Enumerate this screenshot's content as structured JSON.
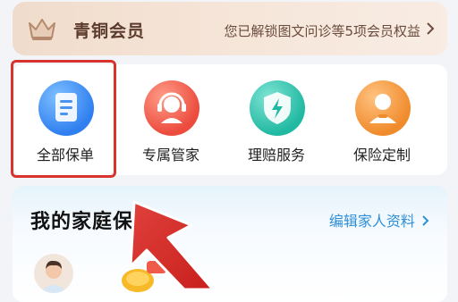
{
  "member_banner": {
    "title": "青铜会员",
    "description": "您已解锁图文问诊等5项会员权益"
  },
  "services": [
    {
      "label": "全部保单",
      "icon": "policy-document-icon"
    },
    {
      "label": "专属管家",
      "icon": "customer-service-icon"
    },
    {
      "label": "理赔服务",
      "icon": "claims-shield-icon"
    },
    {
      "label": "保险定制",
      "icon": "insurance-custom-icon"
    }
  ],
  "family": {
    "title": "我的家庭保障",
    "edit_link": "编辑家人资料"
  },
  "colors": {
    "highlight": "#d9332f",
    "link": "#2f8fd7",
    "member_text": "#5b3b2c"
  }
}
